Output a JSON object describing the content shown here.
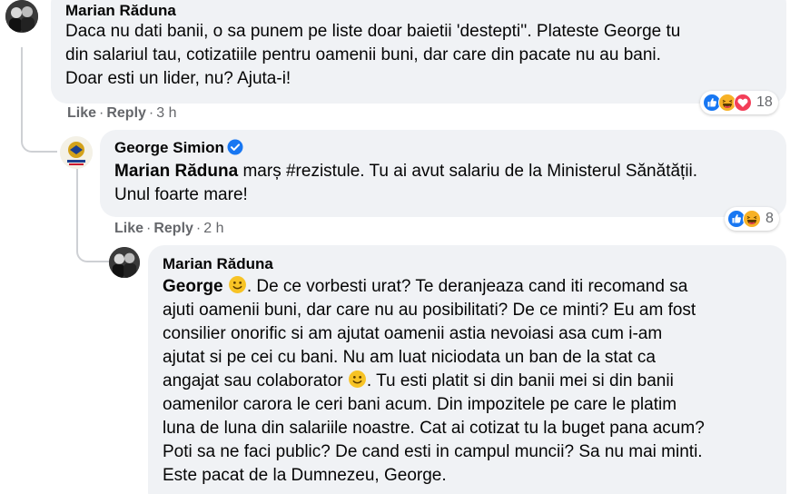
{
  "comments": [
    {
      "author": "Marian Răduna",
      "text": "Daca nu dati banii, o sa punem pe liste doar baietii 'destepti''. Plateste George tu\ndin salariul tau, cotizatiile pentru oamenii buni, dar care din pacate nu au bani.\nDoar esti un lider, nu? Ajuta-i!",
      "like_label": "Like",
      "reply_label": "Reply",
      "time": "3 h",
      "reaction_count": "18",
      "reaction_icons": [
        "like-icon",
        "haha-icon",
        "love-icon"
      ]
    },
    {
      "author": "George Simion",
      "verified": true,
      "mention": "Marian Răduna",
      "text_line1": " marș #rezistule. Tu ai avut salariu de la Ministerul Sănătății.",
      "text_line2": "Unul foarte mare!",
      "like_label": "Like",
      "reply_label": "Reply",
      "time": "2 h",
      "reaction_count": "8",
      "reaction_icons": [
        "like-icon",
        "haha-icon"
      ]
    },
    {
      "author": "Marian Răduna",
      "mention": "George",
      "text_part1": ". De ce vorbesti urat? Te deranjeaza cand iti recomand sa\najuti oamenii buni, dar care nu au posibilitati? De ce minti? Eu am fost\nconsilier onorific si am ajutat oamenii astia nevoiasi asa cum i-am\najutat si pe cei cu bani. Nu am luat niciodata un ban de la stat ca\nangajat sau colaborator ",
      "text_part2": ". Tu esti platit si din banii mei si din banii\noamenilor carora le ceri bani acum. Din impozitele pe care le platim\nluna de luna din salariile noastre. Cat ai cotizat tu la buget pana acum?\nPoti sa ne faci public? De cand esti in campul muncii? Sa nu mai minti.\nEste pacat de la Dumnezeu, George.",
      "emoji": "smile-emoji"
    }
  ],
  "colors": {
    "bubble": "#f0f2f5",
    "meta": "#65676b",
    "like_blue": "#1877f2",
    "haha_yellow": "#f7b125",
    "love_red": "#f33e58",
    "thread_line": "#ced0d4"
  }
}
